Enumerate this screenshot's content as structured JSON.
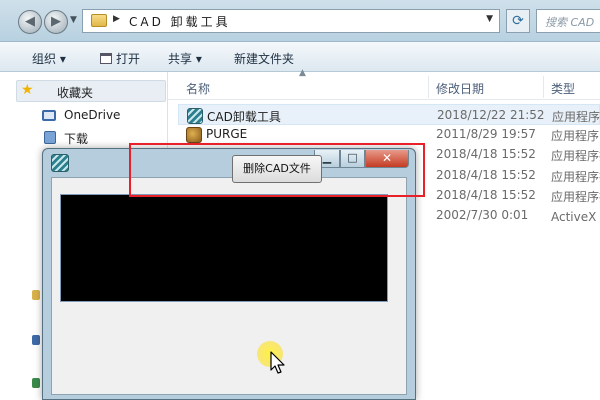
{
  "explorer": {
    "address_path": "CAD 卸载工具",
    "search_placeholder": "搜索 CAD",
    "toolbar": {
      "organize": "组织 ▾",
      "open": "打开",
      "share": "共享 ▾",
      "new_folder": "新建文件夹"
    },
    "nav": {
      "favorites": "收藏夹",
      "items": [
        "OneDrive",
        "下载"
      ]
    },
    "columns": {
      "name": "名称",
      "date": "修改日期",
      "type": "类型"
    },
    "files": [
      {
        "name": "CAD卸载工具",
        "date": "2018/12/22 21:52",
        "type": "应用程序",
        "selected": true
      },
      {
        "name": "PURGE",
        "date": "2011/8/29 19:57",
        "type": "应用程序",
        "selected": false
      },
      {
        "name": "",
        "date": "2018/4/18 15:52",
        "type": "应用程序扩",
        "selected": false
      },
      {
        "name": "",
        "date": "2018/4/18 15:52",
        "type": "应用程序扩",
        "selected": false
      },
      {
        "name": "",
        "date": "2018/4/18 15:52",
        "type": "应用程序扩",
        "selected": false
      },
      {
        "name": "",
        "date": "2002/7/30 0:01",
        "type": "ActiveX 控",
        "selected": false
      }
    ]
  },
  "dialog": {
    "delete_button_label": "删除CAD文件",
    "highlight_color": "#e8202a"
  }
}
